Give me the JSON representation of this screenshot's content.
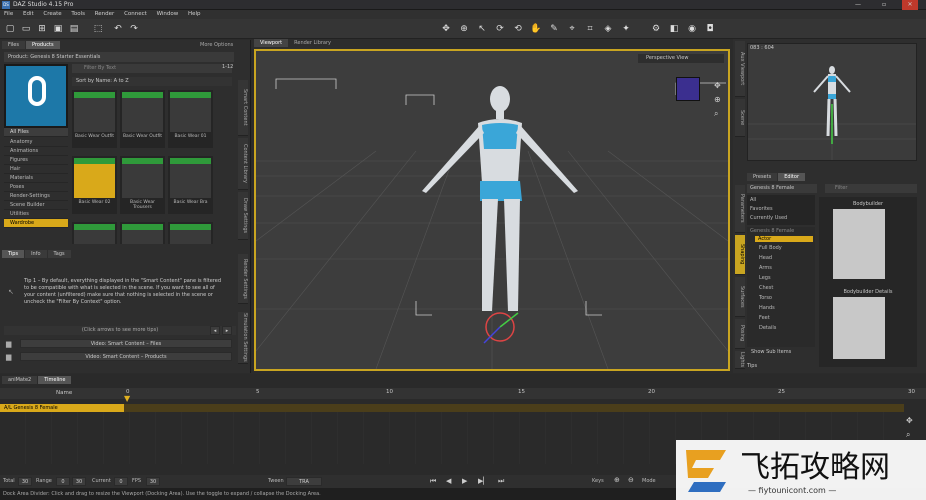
{
  "titlebar": {
    "logo": "DS",
    "title": "DAZ Studio 4.15 Pro",
    "min": "—",
    "max": "▫",
    "close": "✕"
  },
  "menus": [
    "File",
    "Edit",
    "Create",
    "Tools",
    "Render",
    "Connect",
    "Window",
    "Help"
  ],
  "left": {
    "tabs": [
      "Files",
      "Products"
    ],
    "more_options": "More Options",
    "product_label": "Product: Genesis 8 Starter Essentials",
    "search_placeholder": "Filter By Text",
    "sort": "Sort by Name: A to Z",
    "count": "1-12",
    "categories": [
      "All Files",
      "Anatomy",
      "Animations",
      "Figures",
      "Hair",
      "Materials",
      "Poses",
      "Render-Settings",
      "Scene Builder",
      "Utilities",
      "Wardrobe"
    ],
    "thumbs": [
      "Basic Wear Outfit",
      "Basic Wear Outfit",
      "Basic Wear 01",
      "Basic Wear 02",
      "Basic Wear Trousers",
      "Basic Wear Bra",
      "Wardrobe",
      "Wardrobe",
      "Wardrobe"
    ],
    "thumb_badge": "Wardrobe",
    "side_tabs": [
      "Smart Content",
      "Content Library",
      "Draw Settings",
      "Render Settings",
      "Simulation Settings"
    ],
    "tips_tabs": [
      "Tips",
      "Info",
      "Tags"
    ],
    "tip_text": "Tip 1 – By default, everything displayed in the \"Smart Content\" pane is filtered to be compatible with what is selected in the scene. If you want to see all of your content (unfiltered) make sure that nothing is selected in the scene or uncheck the \"Filter By Context\" option.",
    "tip_nav": "(Click arrows to see more tips)",
    "video1": "Video: Smart Content – Files",
    "video2": "Video: Smart Content – Products"
  },
  "viewport": {
    "tabs": [
      "Viewport",
      "Render Library"
    ],
    "view_label": "Perspective View"
  },
  "right": {
    "preview_label": "083 : 604",
    "tabs": [
      "Presets",
      "Editor"
    ],
    "figure_select": "Genesis 8 Female",
    "search_placeholder": "Filter",
    "list": [
      "All",
      "Favorites",
      "Currently Used"
    ],
    "tree": [
      "Genesis 8 Female",
      "Actor",
      "Full Body",
      "Head",
      "Arms",
      "Legs",
      "Chest",
      "Torso",
      "Hands",
      "Feet",
      "Details"
    ],
    "thumb1_label": "Bodybuilder",
    "thumb2_label": "Bodybuilder Details",
    "show_sub": "Show Sub Items",
    "side_tabs": [
      "Aux Viewport",
      "Scene",
      "Parameters",
      "Shaping",
      "Surfaces",
      "Posing",
      "Lights"
    ],
    "tips": "Tips"
  },
  "timeline": {
    "tabs": [
      "aniMate2",
      "Timeline"
    ],
    "name_header": "Name",
    "row": "A/L Genesis 8 Female",
    "ticks": [
      "0",
      "5",
      "10",
      "15",
      "20",
      "25",
      "30"
    ],
    "total_label": "Total",
    "total": "30",
    "range_label": "Range",
    "range_start": "0",
    "range_end": "30",
    "current_label": "Current",
    "current": "0",
    "fps_label": "FPS",
    "fps": "30",
    "tween_label": "Tween",
    "tween": "TRA",
    "keys_label": "Keys",
    "mode_label": "Mode"
  },
  "status": "Dock Area Divider: Click and drag to resize the Viewport (Docking Area). Use the toggle to expand / collapse the Docking Area.",
  "watermark": {
    "cn": "飞拓攻略网",
    "url": "— fiytounicont.com —"
  }
}
